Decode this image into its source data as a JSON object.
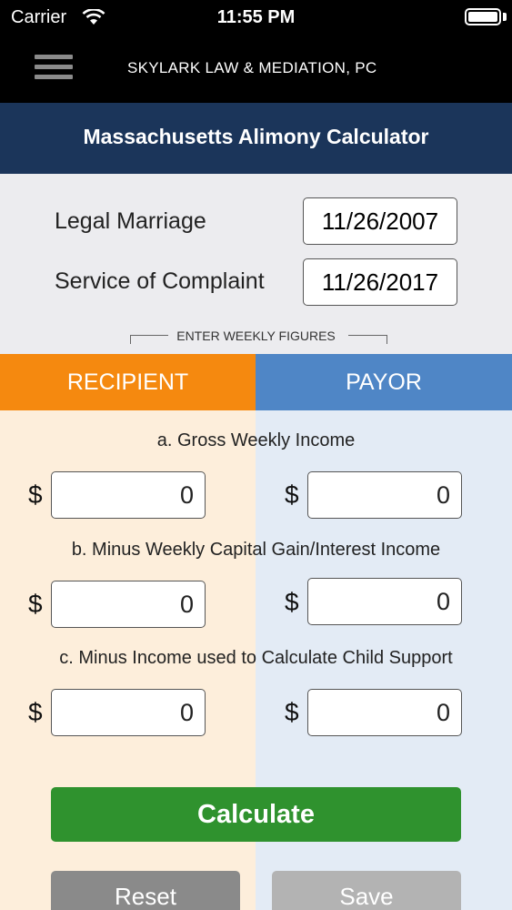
{
  "status_bar": {
    "carrier": "Carrier",
    "time": "11:55 PM",
    "icons": [
      "wifi-icon",
      "battery-icon"
    ]
  },
  "nav": {
    "menu_icon": "hamburger-menu-icon",
    "brand": "SKYLARK LAW & MEDIATION, PC"
  },
  "header": {
    "title": "Massachusetts Alimony Calculator"
  },
  "dates": {
    "legal_marriage": {
      "label": "Legal Marriage",
      "value": "11/26/2007"
    },
    "service_of_complaint": {
      "label": "Service of Complaint",
      "value": "11/26/2017"
    },
    "weekly_note": "ENTER WEEKLY FIGURES"
  },
  "tabs": {
    "recipient": "RECIPIENT",
    "payor": "PAYOR"
  },
  "rows": [
    {
      "label": "a. Gross Weekly Income",
      "recipient": "0",
      "payor": "0"
    },
    {
      "label": "b. Minus Weekly Capital Gain/Interest Income",
      "recipient": "0",
      "payor": "0"
    },
    {
      "label": "c. Minus Income used to Calculate Child Support",
      "recipient": "0",
      "payor": "0"
    }
  ],
  "currency": "$",
  "buttons": {
    "calculate": "Calculate",
    "reset": "Reset",
    "save": "Save"
  },
  "colors": {
    "header_bg": "#1b355a",
    "recipient": "#f5890f",
    "payor": "#4f86c6",
    "calculate": "#2f922e"
  }
}
